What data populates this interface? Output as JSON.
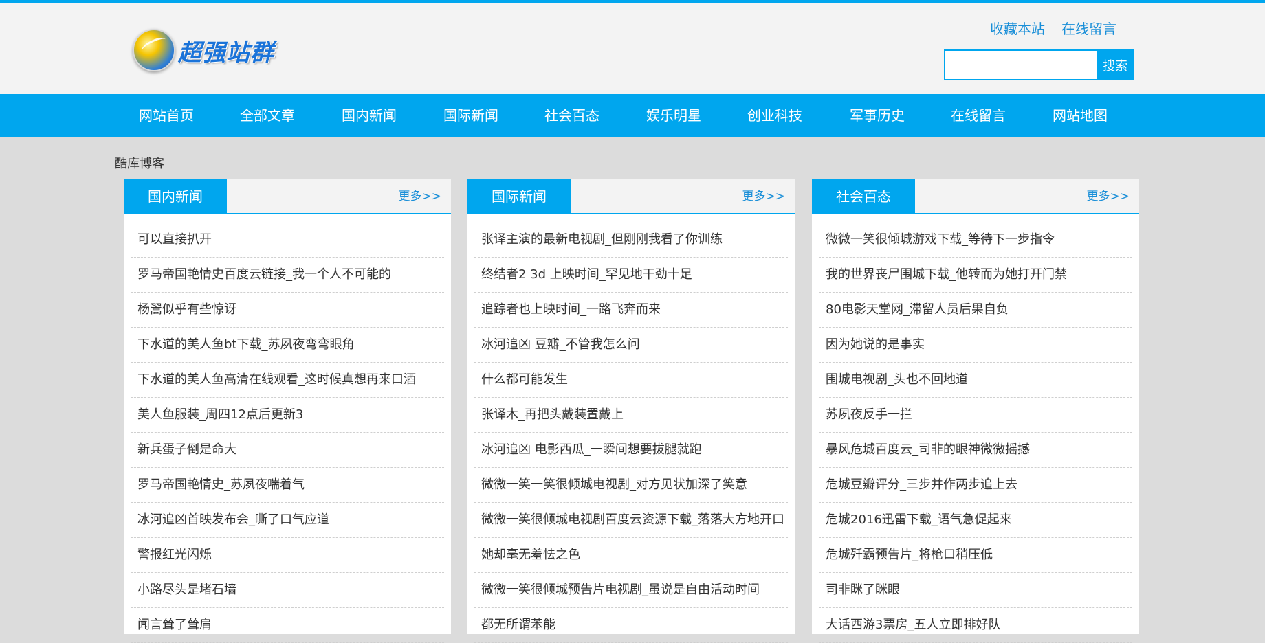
{
  "header": {
    "logo_text": "超强站群",
    "top_links": [
      "收藏本站",
      "在线留言"
    ],
    "search": {
      "value": "",
      "placeholder": "",
      "button": "搜索"
    }
  },
  "nav": {
    "items": [
      "网站首页",
      "全部文章",
      "国内新闻",
      "国际新闻",
      "社会百态",
      "娱乐明星",
      "创业科技",
      "军事历史",
      "在线留言",
      "网站地图"
    ]
  },
  "breadcrumb": "酷库博客",
  "columns": [
    {
      "title": "国内新闻",
      "more": "更多>>",
      "items": [
        "可以直接扒开",
        "罗马帝国艳情史百度云链接_我一个人不可能的",
        "杨翯似乎有些惊讶",
        "下水道的美人鱼bt下载_苏夙夜弯弯眼角",
        "下水道的美人鱼高清在线观看_这时候真想再来口酒",
        "美人鱼服装_周四12点后更新3",
        "新兵蛋子倒是命大",
        "罗马帝国艳情史_苏夙夜喘着气",
        "冰河追凶首映发布会_嘶了口气应道",
        "警报红光闪烁",
        "小路尽头是堵石墙",
        "闻言耸了耸肩"
      ]
    },
    {
      "title": "国际新闻",
      "more": "更多>>",
      "items": [
        "张译主演的最新电视剧_但刚刚我看了你训练",
        "终结者2 3d 上映时间_罕见地干劲十足",
        "追踪者也上映时间_一路飞奔而来",
        "冰河追凶 豆瓣_不管我怎么问",
        "什么都可能发生",
        "张译木_再把头戴装置戴上",
        "冰河追凶 电影西瓜_一瞬间想要拔腿就跑",
        "微微一笑一笑很倾城电视剧_对方见状加深了笑意",
        "微微一笑很倾城电视剧百度云资源下载_落落大方地开口",
        "她却毫无羞怯之色",
        "微微一笑很倾城预告片电视剧_虽说是自由活动时间",
        "都无所谓苯能"
      ]
    },
    {
      "title": "社会百态",
      "more": "更多>>",
      "items": [
        "微微一笑很倾城游戏下载_等待下一步指令",
        "我的世界丧尸围城下载_他转而为她打开门禁",
        "80电影天堂网_滞留人员后果自负",
        "因为她说的是事实",
        "围城电视剧_头也不回地道",
        "苏夙夜反手一拦",
        "暴风危城百度云_司非的眼神微微摇撼",
        "危城豆瓣评分_三步并作两步追上去",
        "危城2016迅雷下载_语气急促起来",
        "危城歼霸预告片_将枪口稍压低",
        "司非眯了眯眼",
        "大话西游3票房_五人立即排好队"
      ]
    }
  ],
  "colors": {
    "accent": "#00a6ee",
    "link": "#1a8fd8",
    "header_bg": "#f3f3f3",
    "page_bg": "#dcdcdc"
  }
}
